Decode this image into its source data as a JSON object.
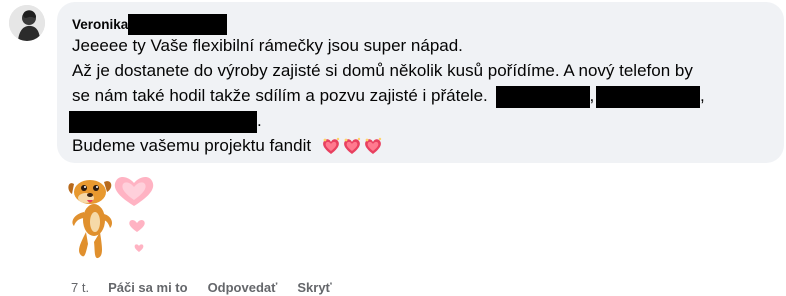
{
  "comment": {
    "author": "Veronika",
    "lines": [
      "Jeeeee ty Vaše flexibilní rámečky jsou super nápad.",
      "Až je dostanete do výroby zajisté si domů několik kusů pořídíme. A nový telefon by",
      "se nám také hodil takže sdílím a pozvu zajisté i přátele.",
      ",",
      ",",
      ".",
      "Budeme vašemu projektu fandit"
    ],
    "colors": {
      "bubble": "#f0f2f5",
      "redaction": "#000000",
      "heart": "#e8405f"
    },
    "reaction_icons": [
      "sparkling-heart-icon",
      "sparkling-heart-icon",
      "sparkling-heart-icon"
    ]
  },
  "sticker": {
    "name": "dog-with-hearts-sticker"
  },
  "actions": {
    "time": "7 t.",
    "like": "Páči sa mi to",
    "reply": "Odpovedať",
    "hide": "Skryť"
  }
}
